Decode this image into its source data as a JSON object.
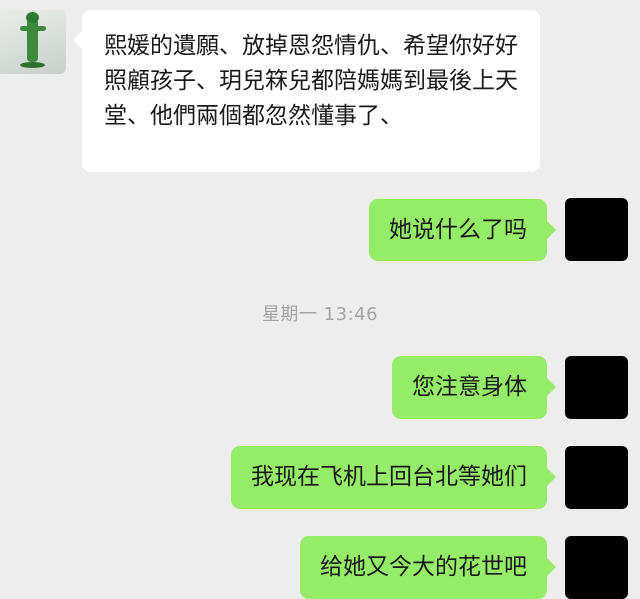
{
  "conversation": {
    "incoming": {
      "text": "熙媛的遺願、放掉恩怨情仇、希望你好好照顧孩子、玥兒箖兒都陪媽媽到最後上天堂、他們兩個都忽然懂事了、"
    },
    "timestamp": "星期一 13:46",
    "outgoing": [
      {
        "text": "她说什么了吗"
      },
      {
        "text": "您注意身体"
      },
      {
        "text": "我现在飞机上回台北等她们"
      },
      {
        "text": "给她又今大的花世吧"
      }
    ]
  }
}
